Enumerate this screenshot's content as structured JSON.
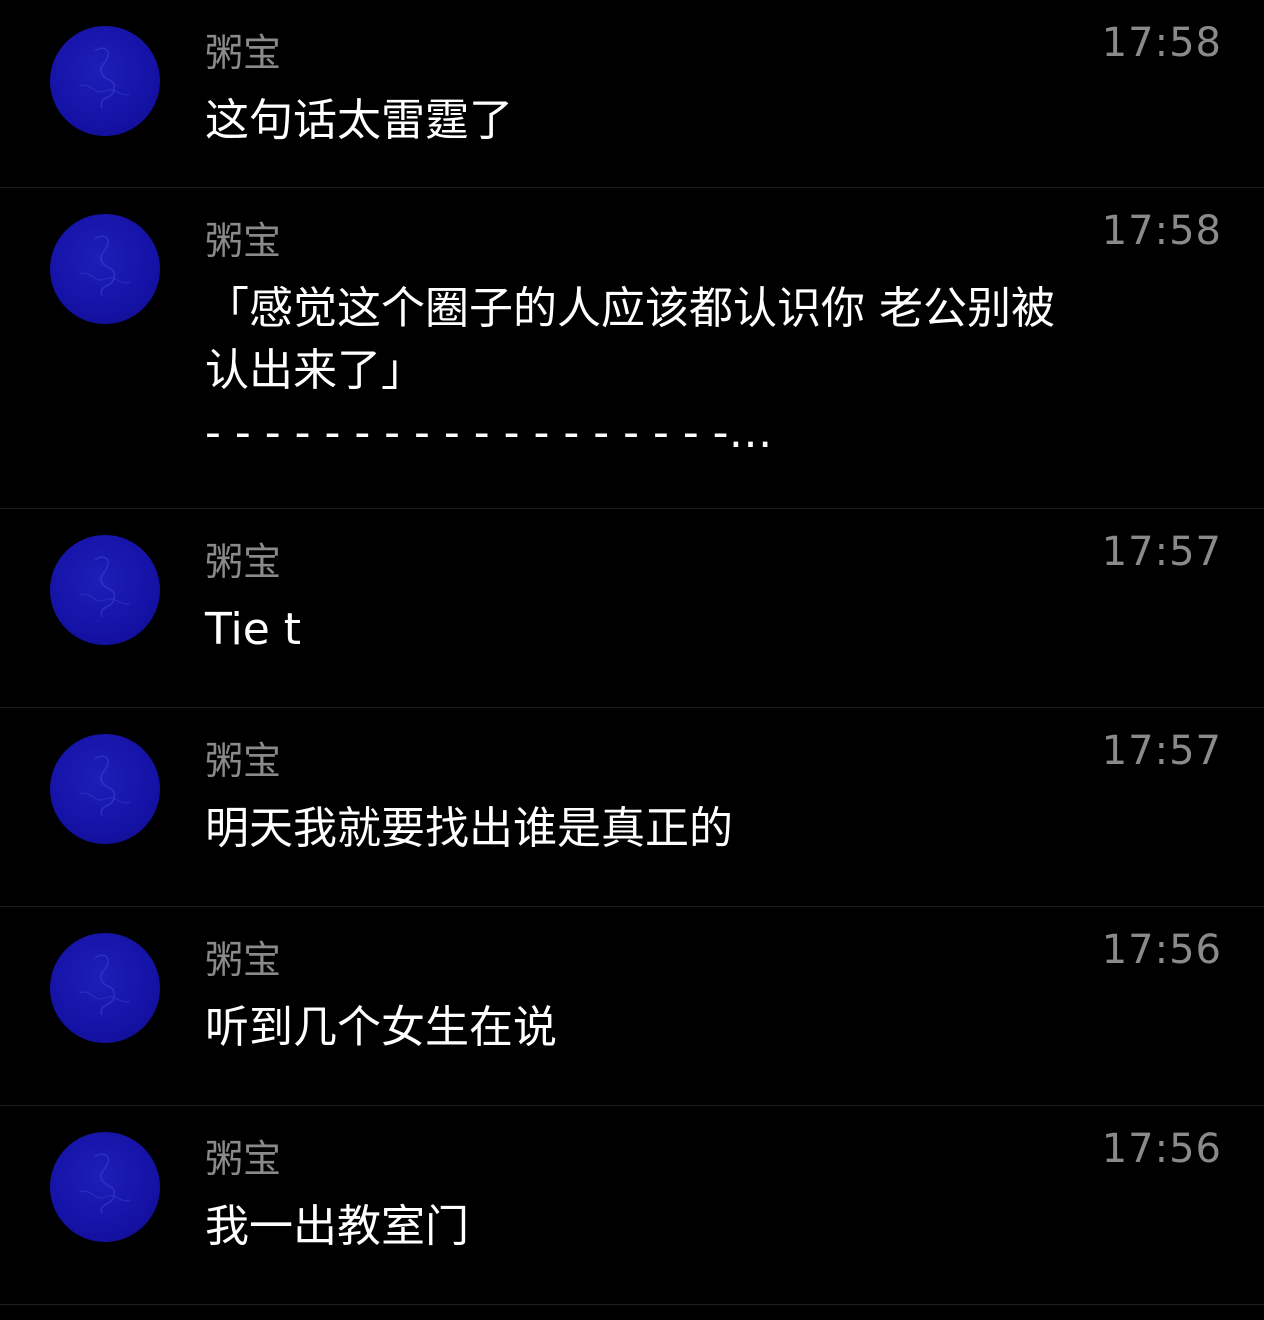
{
  "chats": [
    {
      "sender": "粥宝",
      "time": "17:58",
      "text": "这句话太雷霆了"
    },
    {
      "sender": "粥宝",
      "time": "17:58",
      "text": "「感觉这个圈子的人应该都认识你 老公别被认出来了」\n- - - - - - - - - - - - - - - - - -…"
    },
    {
      "sender": "粥宝",
      "time": "17:57",
      "text": "Tie t"
    },
    {
      "sender": "粥宝",
      "time": "17:57",
      "text": "明天我就要找出谁是真正的"
    },
    {
      "sender": "粥宝",
      "time": "17:56",
      "text": "听到几个女生在说"
    },
    {
      "sender": "粥宝",
      "time": "17:56",
      "text": "我一出教室门"
    }
  ],
  "colors": {
    "background": "#000000",
    "avatar": "#1512a6",
    "secondary_text": "#8a8a8a",
    "primary_text": "#ffffff"
  },
  "icons": {
    "avatar": "blue-circle-avatar"
  }
}
